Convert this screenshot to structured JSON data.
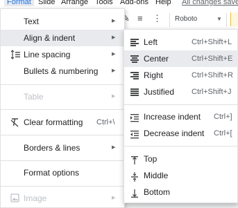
{
  "menubar": {
    "items": [
      "Format",
      "Slide",
      "Arrange",
      "Tools",
      "Add-ons",
      "Help"
    ],
    "saved_text": "All changes saved"
  },
  "toolbar": {
    "font_name": "Roboto"
  },
  "format_menu": {
    "items": [
      {
        "label": "Text",
        "submenu": true
      },
      {
        "label": "Align & indent",
        "submenu": true,
        "highlight": true
      },
      {
        "label": "Line spacing",
        "submenu": true,
        "icon": "line-spacing-icon"
      },
      {
        "label": "Bullets & numbering",
        "submenu": true
      },
      {
        "label": "Table",
        "submenu": true,
        "disabled": true
      },
      {
        "label": "Clear formatting",
        "shortcut": "Ctrl+\\",
        "icon": "clear-formatting-icon"
      },
      {
        "label": "Borders & lines",
        "submenu": true
      },
      {
        "label": "Format options"
      },
      {
        "label": "Image",
        "submenu": true,
        "disabled": true,
        "icon": "image-icon"
      }
    ]
  },
  "align_submenu": {
    "items": [
      {
        "label": "Left",
        "shortcut": "Ctrl+Shift+L",
        "icon": "align-left-icon"
      },
      {
        "label": "Center",
        "shortcut": "Ctrl+Shift+E",
        "icon": "align-center-icon",
        "highlight": true
      },
      {
        "label": "Right",
        "shortcut": "Ctrl+Shift+R",
        "icon": "align-right-icon"
      },
      {
        "label": "Justified",
        "shortcut": "Ctrl+Shift+J",
        "icon": "align-justify-icon"
      },
      {
        "label": "Increase indent",
        "shortcut": "Ctrl+]",
        "icon": "increase-indent-icon"
      },
      {
        "label": "Decrease indent",
        "shortcut": "Ctrl+[",
        "icon": "decrease-indent-icon"
      },
      {
        "label": "Top",
        "icon": "vertical-align-top-icon"
      },
      {
        "label": "Middle",
        "icon": "vertical-align-middle-icon"
      },
      {
        "label": "Bottom",
        "icon": "vertical-align-bottom-icon"
      }
    ]
  }
}
